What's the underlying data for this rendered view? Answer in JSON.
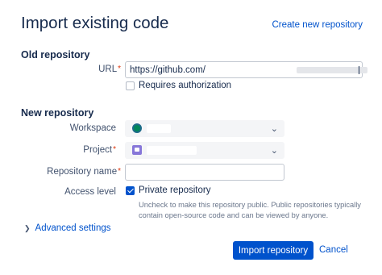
{
  "header": {
    "title": "Import existing code",
    "create_link": "Create new repository"
  },
  "old_repo": {
    "heading": "Old repository",
    "url_label": "URL",
    "url_value": "https://github.com/",
    "requires_auth_label": "Requires authorization",
    "requires_auth_checked": false
  },
  "new_repo": {
    "heading": "New repository",
    "workspace_label": "Workspace",
    "project_label": "Project",
    "repo_name_label": "Repository name",
    "repo_name_value": "",
    "access_label": "Access level",
    "private_label": "Private repository",
    "private_checked": true,
    "private_help": "Uncheck to make this repository public. Public repositories typically contain open-source code and can be viewed by anyone."
  },
  "advanced": {
    "label": "Advanced settings"
  },
  "actions": {
    "import_label": "Import repository",
    "cancel_label": "Cancel"
  },
  "colors": {
    "primary": "#0052cc",
    "required": "#de350b",
    "text": "#172b4d"
  },
  "icons": {
    "workspace": "workspace-avatar-icon",
    "project": "project-avatar-icon",
    "chevron": "chevron-down-icon",
    "expand": "chevron-right-icon"
  }
}
